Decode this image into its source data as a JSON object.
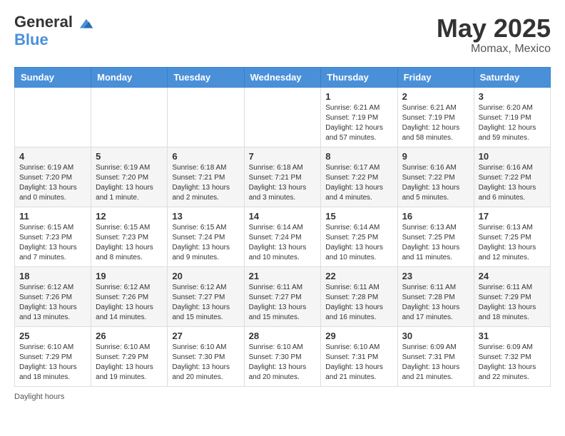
{
  "header": {
    "logo_general": "General",
    "logo_blue": "Blue",
    "month": "May 2025",
    "location": "Momax, Mexico"
  },
  "weekdays": [
    "Sunday",
    "Monday",
    "Tuesday",
    "Wednesday",
    "Thursday",
    "Friday",
    "Saturday"
  ],
  "weeks": [
    [
      {
        "day": "",
        "info": ""
      },
      {
        "day": "",
        "info": ""
      },
      {
        "day": "",
        "info": ""
      },
      {
        "day": "",
        "info": ""
      },
      {
        "day": "1",
        "info": "Sunrise: 6:21 AM\nSunset: 7:19 PM\nDaylight: 12 hours and 57 minutes."
      },
      {
        "day": "2",
        "info": "Sunrise: 6:21 AM\nSunset: 7:19 PM\nDaylight: 12 hours and 58 minutes."
      },
      {
        "day": "3",
        "info": "Sunrise: 6:20 AM\nSunset: 7:19 PM\nDaylight: 12 hours and 59 minutes."
      }
    ],
    [
      {
        "day": "4",
        "info": "Sunrise: 6:19 AM\nSunset: 7:20 PM\nDaylight: 13 hours and 0 minutes."
      },
      {
        "day": "5",
        "info": "Sunrise: 6:19 AM\nSunset: 7:20 PM\nDaylight: 13 hours and 1 minute."
      },
      {
        "day": "6",
        "info": "Sunrise: 6:18 AM\nSunset: 7:21 PM\nDaylight: 13 hours and 2 minutes."
      },
      {
        "day": "7",
        "info": "Sunrise: 6:18 AM\nSunset: 7:21 PM\nDaylight: 13 hours and 3 minutes."
      },
      {
        "day": "8",
        "info": "Sunrise: 6:17 AM\nSunset: 7:22 PM\nDaylight: 13 hours and 4 minutes."
      },
      {
        "day": "9",
        "info": "Sunrise: 6:16 AM\nSunset: 7:22 PM\nDaylight: 13 hours and 5 minutes."
      },
      {
        "day": "10",
        "info": "Sunrise: 6:16 AM\nSunset: 7:22 PM\nDaylight: 13 hours and 6 minutes."
      }
    ],
    [
      {
        "day": "11",
        "info": "Sunrise: 6:15 AM\nSunset: 7:23 PM\nDaylight: 13 hours and 7 minutes."
      },
      {
        "day": "12",
        "info": "Sunrise: 6:15 AM\nSunset: 7:23 PM\nDaylight: 13 hours and 8 minutes."
      },
      {
        "day": "13",
        "info": "Sunrise: 6:15 AM\nSunset: 7:24 PM\nDaylight: 13 hours and 9 minutes."
      },
      {
        "day": "14",
        "info": "Sunrise: 6:14 AM\nSunset: 7:24 PM\nDaylight: 13 hours and 10 minutes."
      },
      {
        "day": "15",
        "info": "Sunrise: 6:14 AM\nSunset: 7:25 PM\nDaylight: 13 hours and 10 minutes."
      },
      {
        "day": "16",
        "info": "Sunrise: 6:13 AM\nSunset: 7:25 PM\nDaylight: 13 hours and 11 minutes."
      },
      {
        "day": "17",
        "info": "Sunrise: 6:13 AM\nSunset: 7:25 PM\nDaylight: 13 hours and 12 minutes."
      }
    ],
    [
      {
        "day": "18",
        "info": "Sunrise: 6:12 AM\nSunset: 7:26 PM\nDaylight: 13 hours and 13 minutes."
      },
      {
        "day": "19",
        "info": "Sunrise: 6:12 AM\nSunset: 7:26 PM\nDaylight: 13 hours and 14 minutes."
      },
      {
        "day": "20",
        "info": "Sunrise: 6:12 AM\nSunset: 7:27 PM\nDaylight: 13 hours and 15 minutes."
      },
      {
        "day": "21",
        "info": "Sunrise: 6:11 AM\nSunset: 7:27 PM\nDaylight: 13 hours and 15 minutes."
      },
      {
        "day": "22",
        "info": "Sunrise: 6:11 AM\nSunset: 7:28 PM\nDaylight: 13 hours and 16 minutes."
      },
      {
        "day": "23",
        "info": "Sunrise: 6:11 AM\nSunset: 7:28 PM\nDaylight: 13 hours and 17 minutes."
      },
      {
        "day": "24",
        "info": "Sunrise: 6:11 AM\nSunset: 7:29 PM\nDaylight: 13 hours and 18 minutes."
      }
    ],
    [
      {
        "day": "25",
        "info": "Sunrise: 6:10 AM\nSunset: 7:29 PM\nDaylight: 13 hours and 18 minutes."
      },
      {
        "day": "26",
        "info": "Sunrise: 6:10 AM\nSunset: 7:29 PM\nDaylight: 13 hours and 19 minutes."
      },
      {
        "day": "27",
        "info": "Sunrise: 6:10 AM\nSunset: 7:30 PM\nDaylight: 13 hours and 20 minutes."
      },
      {
        "day": "28",
        "info": "Sunrise: 6:10 AM\nSunset: 7:30 PM\nDaylight: 13 hours and 20 minutes."
      },
      {
        "day": "29",
        "info": "Sunrise: 6:10 AM\nSunset: 7:31 PM\nDaylight: 13 hours and 21 minutes."
      },
      {
        "day": "30",
        "info": "Sunrise: 6:09 AM\nSunset: 7:31 PM\nDaylight: 13 hours and 21 minutes."
      },
      {
        "day": "31",
        "info": "Sunrise: 6:09 AM\nSunset: 7:32 PM\nDaylight: 13 hours and 22 minutes."
      }
    ]
  ],
  "footer": {
    "daylight_label": "Daylight hours"
  }
}
